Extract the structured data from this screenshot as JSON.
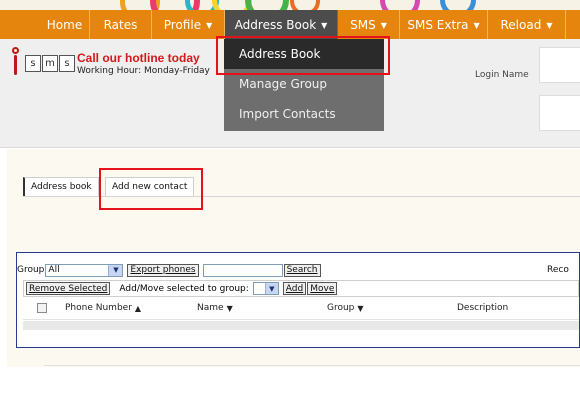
{
  "nav": {
    "items": [
      {
        "label": "Home",
        "caret": false
      },
      {
        "label": "Rates",
        "caret": false
      },
      {
        "label": "Profile",
        "caret": true
      },
      {
        "label": "Address Book",
        "caret": true
      },
      {
        "label": "SMS",
        "caret": true
      },
      {
        "label": "SMS Extra",
        "caret": true
      },
      {
        "label": "Reload",
        "caret": true
      }
    ]
  },
  "header": {
    "logo_letters": [
      "s",
      "m",
      "s"
    ],
    "hotline": "Call our hotline today",
    "hours": "Working Hour: Monday-Friday",
    "login_label": "Login Name"
  },
  "dropdown": {
    "items": [
      "Address Book",
      "Manage Group",
      "Import Contacts"
    ]
  },
  "tabs": {
    "address_book": "Address book",
    "add_new_contact": "Add new contact"
  },
  "toolbar": {
    "group_label": "Group",
    "group_value": "All",
    "export_button": "Export phones",
    "search_button": "Search",
    "records_label": "Reco",
    "remove_button": "Remove Selected",
    "addmove_label": "Add/Move selected to group:",
    "add_button": "Add",
    "move_button": "Move"
  },
  "table": {
    "columns": [
      "Phone Number",
      "Name",
      "Group",
      "Description"
    ]
  },
  "colors": {
    "nav_orange": "#e6850e",
    "nav_active": "#4c4c4c",
    "highlight_red": "#e4121b",
    "hotline_red": "#d11a1a"
  }
}
